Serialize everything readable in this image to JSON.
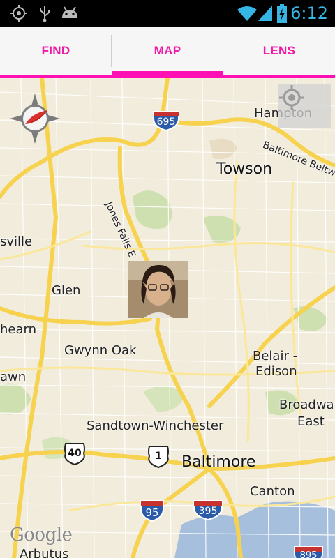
{
  "status_bar": {
    "time": "6:12",
    "left_icons": [
      "gps-icon",
      "usb-icon",
      "android-debug-icon"
    ],
    "right_icons": [
      "wifi-icon",
      "cell-signal-icon",
      "battery-charging-icon"
    ],
    "accent_color": "#35b6e5"
  },
  "tabs": {
    "items": [
      {
        "label": "FIND",
        "selected": false
      },
      {
        "label": "MAP",
        "selected": true
      },
      {
        "label": "LENS",
        "selected": false
      }
    ],
    "accent_color": "#ff10b4"
  },
  "map": {
    "places": {
      "hampton": "Hampton",
      "towson": "Towson",
      "baltimore_beltway": "Baltimore Beltw",
      "jones_falls": "Jones Falls E",
      "sville": "sville",
      "glen": "Glen",
      "hearn": "hearn",
      "gwynn_oak": "Gwynn Oak",
      "belair_edison_1": "Belair -",
      "belair_edison_2": "Edison",
      "awn": "awn",
      "broadway_1": "Broadwa",
      "broadway_2": "East",
      "sandtown": "Sandtown-Winchester",
      "baltimore": "Baltimore",
      "canton": "Canton",
      "arbutus": "Arbutus"
    },
    "shields": {
      "i695": "695",
      "i95": "95",
      "i395": "395",
      "i895": "895",
      "us40": "40",
      "us1": "1"
    },
    "attribution": "Google"
  },
  "controls": {
    "compass_icon": "compass-icon",
    "locate_icon": "my-location-icon",
    "avatar_icon": "user-avatar"
  }
}
